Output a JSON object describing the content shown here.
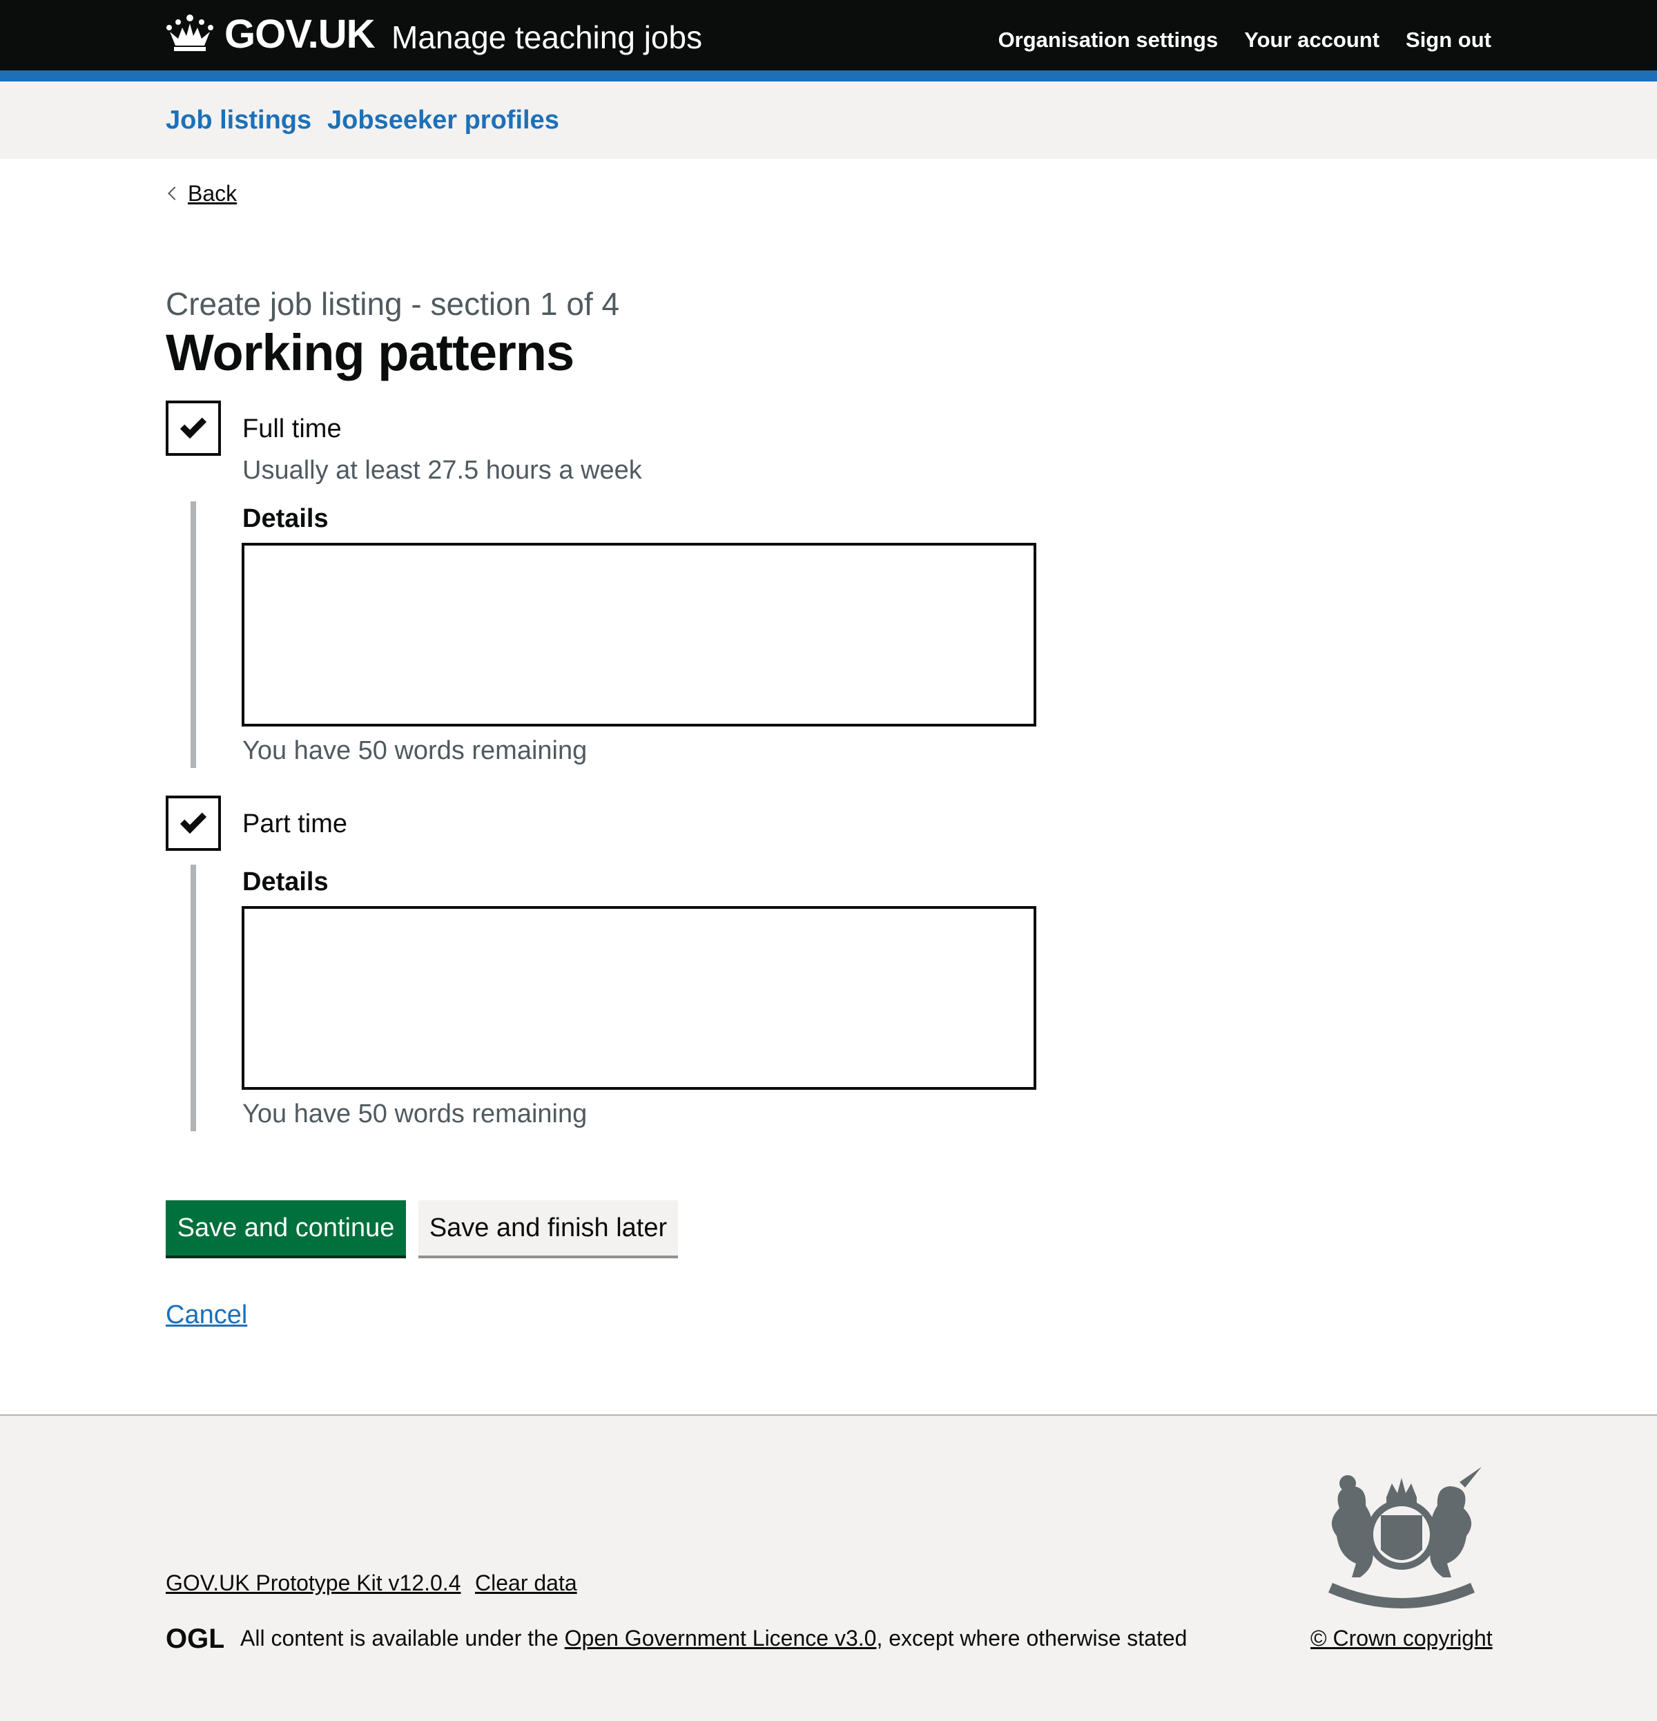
{
  "header": {
    "logo_text": "GOV.UK",
    "service_name": "Manage teaching jobs",
    "nav": [
      "Organisation settings",
      "Your account",
      "Sign out"
    ]
  },
  "subnav": {
    "items": [
      "Job listings",
      "Jobseeker profiles"
    ]
  },
  "back_link": "Back",
  "caption": "Create job listing - section 1 of 4",
  "title": "Working patterns",
  "options": [
    {
      "label": "Full time",
      "checked": true,
      "hint": "Usually at least 27.5 hours a week",
      "details_label": "Details",
      "details_value": "",
      "word_count": "You have 50 words remaining"
    },
    {
      "label": "Part time",
      "checked": true,
      "details_label": "Details",
      "details_value": "",
      "word_count": "You have 50 words remaining"
    }
  ],
  "buttons": {
    "primary": "Save and continue",
    "secondary": "Save and finish later"
  },
  "cancel_link": "Cancel",
  "footer": {
    "links": [
      "GOV.UK Prototype Kit v12.0.4",
      "Clear data"
    ],
    "licence_prefix": "All content is available under the ",
    "licence_link": "Open Government Licence v3.0",
    "licence_suffix": ", except where otherwise stated",
    "ogl_logo": "OGL",
    "copyright": "© Crown copyright"
  },
  "colors": {
    "header_bg": "#0b0c0c",
    "accent_stripe": "#1d70b8",
    "link": "#1d70b8",
    "primary_button": "#00703c",
    "footer_bg": "#f3f2f1"
  }
}
